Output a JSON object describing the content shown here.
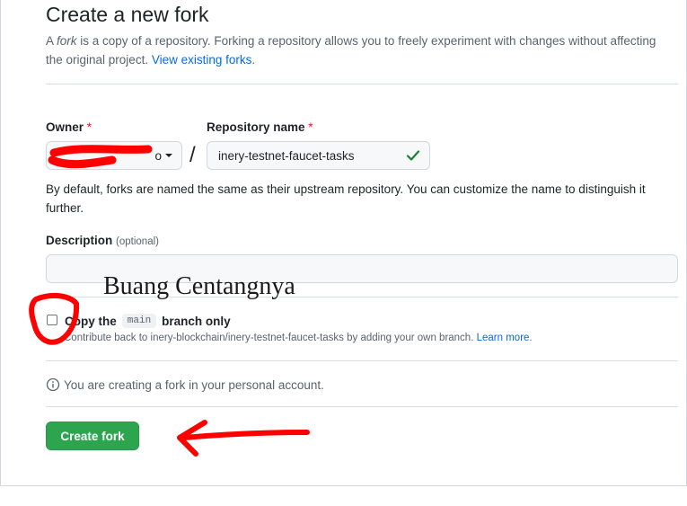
{
  "page": {
    "title": "Create a new fork",
    "intro_prefix": "A ",
    "intro_em": "fork",
    "intro_rest": " is a copy of a repository. Forking a repository allows you to freely experiment with changes without affecting the original project. ",
    "view_forks_link": "View existing forks",
    "intro_suffix": "."
  },
  "owner": {
    "label": "Owner",
    "required_mark": "*",
    "selected_partial": "o",
    "icon": "chevron-down-icon"
  },
  "slash": "/",
  "repository": {
    "label": "Repository name",
    "required_mark": "*",
    "value": "inery-testnet-faucet-tasks",
    "status_icon": "check-icon",
    "status_color": "#1a7f37"
  },
  "name_hint": "By default, forks are named the same as their upstream repository. You can customize the name to distinguish it further.",
  "description": {
    "label": "Description",
    "optional_label": "(optional)",
    "value": ""
  },
  "copy_branch": {
    "checked": false,
    "label_prefix": "Copy the",
    "branch": "main",
    "label_suffix": "branch only",
    "help_text": "Contribute back to inery-blockchain/inery-testnet-faucet-tasks by adding your own branch. ",
    "learn_more": "Learn more",
    "help_suffix": "."
  },
  "info_message": "You are creating a fork in your personal account.",
  "create_button": "Create fork",
  "annotation": {
    "text": "Buang Centangnya",
    "marker_color": "#ff0000"
  },
  "colors": {
    "accent": "#0969da",
    "primary_button": "#2da44e",
    "required": "#d1242f"
  }
}
